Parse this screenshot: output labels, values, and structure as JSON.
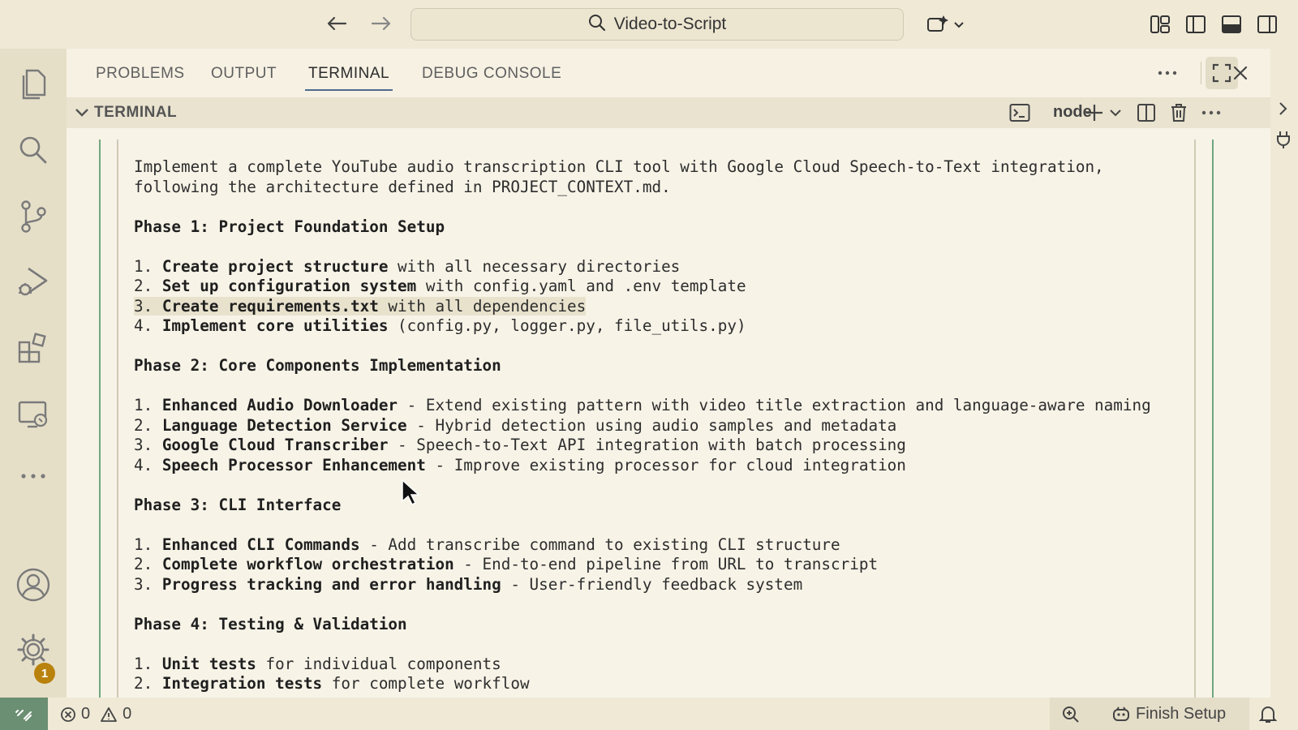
{
  "titlebar": {
    "search_text": "Video-to-Script"
  },
  "activity_bar": {
    "settings_badge": "1"
  },
  "panel": {
    "tabs": [
      {
        "label": "PROBLEMS"
      },
      {
        "label": "OUTPUT"
      },
      {
        "label": "TERMINAL"
      },
      {
        "label": "DEBUG CONSOLE"
      }
    ],
    "active_tab": "TERMINAL",
    "section_title": "TERMINAL",
    "shell_name": "node"
  },
  "terminal": {
    "lines": [
      "Implement a complete YouTube audio transcription CLI tool with Google Cloud Speech-to-Text integration,",
      "following the architecture defined in PROJECT_CONTEXT.md.",
      "",
      "Phase 1: Project Foundation Setup",
      "",
      "1. Create project structure with all necessary directories",
      "2. Set up configuration system with config.yaml and .env template",
      "3. Create requirements.txt with all dependencies",
      "4. Implement core utilities (config.py, logger.py, file_utils.py)",
      "",
      "Phase 2: Core Components Implementation",
      "",
      "1. Enhanced Audio Downloader - Extend existing pattern with video title extraction and language-aware naming",
      "2. Language Detection Service - Hybrid detection using audio samples and metadata",
      "3. Google Cloud Transcriber - Speech-to-Text API integration with batch processing",
      "4. Speech Processor Enhancement - Improve existing processor for cloud integration",
      "",
      "Phase 3: CLI Interface",
      "",
      "1. Enhanced CLI Commands - Add transcribe command to existing CLI structure",
      "2. Complete workflow orchestration - End-to-end pipeline from URL to transcript",
      "3. Progress tracking and error handling - User-friendly feedback system",
      "",
      "Phase 4: Testing & Validation",
      "",
      "1. Unit tests for individual components",
      "2. Integration tests for complete workflow"
    ]
  },
  "statusbar": {
    "errors": "0",
    "warnings": "0",
    "finish_setup": "Finish Setup"
  },
  "colors": {
    "accent": "#4f6a8c",
    "remote": "#6b8f72",
    "badge": "#b9820d",
    "gutter": "#6ea77f"
  }
}
